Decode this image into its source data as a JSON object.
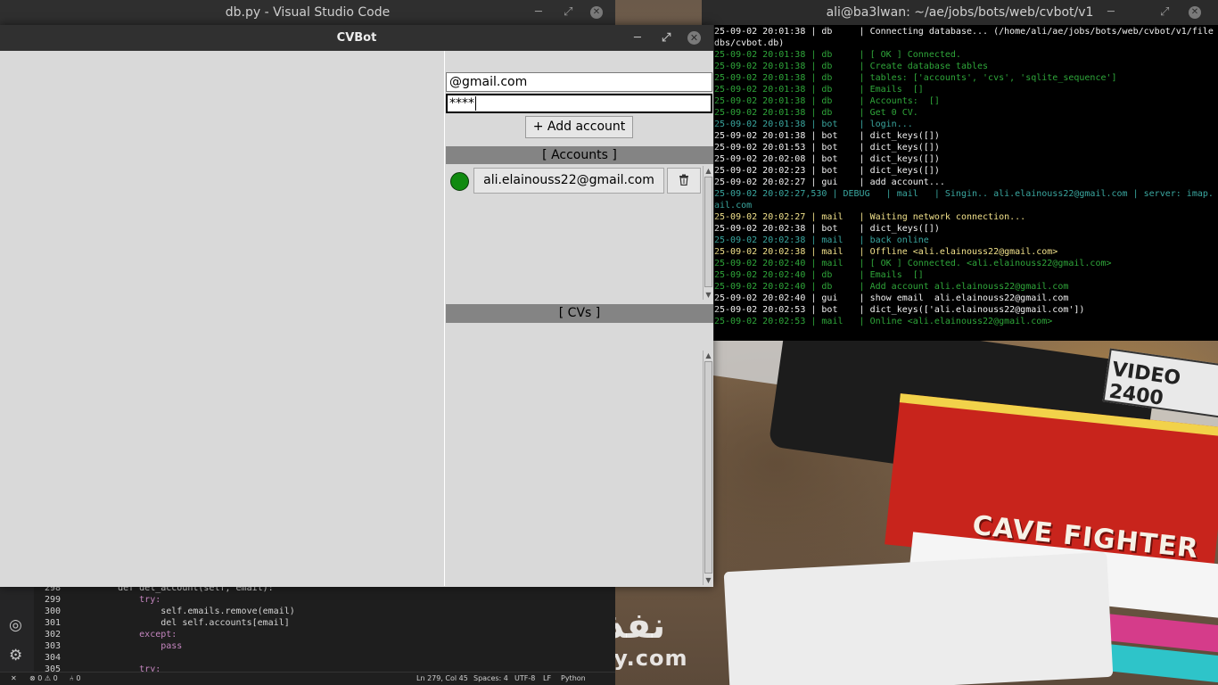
{
  "vscode": {
    "title": "db.py - Visual Studio Code",
    "code_lines": [
      {
        "num": "298",
        "text": "    def del_account(self, email):"
      },
      {
        "num": "299",
        "text": "        try:"
      },
      {
        "num": "300",
        "text": "            self.emails.remove(email)"
      },
      {
        "num": "301",
        "text": "            del self.accounts[email]"
      },
      {
        "num": "302",
        "text": "        except:"
      },
      {
        "num": "303",
        "text": "            pass"
      },
      {
        "num": "304",
        "text": ""
      },
      {
        "num": "305",
        "text": "        try:"
      }
    ],
    "status": {
      "errors": "⊗ 0 ⚠ 0",
      "ports": "⑃ 0",
      "position": "Ln 279, Col 45",
      "spaces": "Spaces: 4",
      "encoding": "UTF-8",
      "eol": "LF",
      "language": "Python"
    }
  },
  "terminal": {
    "title": "ali@ba3lwan: ~/ae/jobs/bots/web/cvbot/v1",
    "lines": [
      {
        "text": "25-09-02 20:01:38 | db     | Connecting database... (/home/ali/ae/jobs/bots/web/cvbot/v1/file",
        "color": "white"
      },
      {
        "text": "dbs/cvbot.db)",
        "color": "white"
      },
      {
        "text": "25-09-02 20:01:38 | db     | [ OK ] Connected.",
        "color": "green"
      },
      {
        "text": "25-09-02 20:01:38 | db     | Create database tables",
        "color": "green"
      },
      {
        "text": "25-09-02 20:01:38 | db     | tables: ['accounts', 'cvs', 'sqlite_sequence']",
        "color": "green"
      },
      {
        "text": "25-09-02 20:01:38 | db     | Emails  []",
        "color": "green"
      },
      {
        "text": "25-09-02 20:01:38 | db     | Accounts:  []",
        "color": "green"
      },
      {
        "text": "25-09-02 20:01:38 | db     | Get 0 CV.",
        "color": "green"
      },
      {
        "text": "25-09-02 20:01:38 | bot    | login...",
        "color": "cyan"
      },
      {
        "text": "25-09-02 20:01:38 | bot    | dict_keys([])",
        "color": "white"
      },
      {
        "text": "25-09-02 20:01:53 | bot    | dict_keys([])",
        "color": "white"
      },
      {
        "text": "25-09-02 20:02:08 | bot    | dict_keys([])",
        "color": "white"
      },
      {
        "text": "25-09-02 20:02:23 | bot    | dict_keys([])",
        "color": "white"
      },
      {
        "text": "25-09-02 20:02:27 | gui    | add account...",
        "color": "white"
      },
      {
        "text": "25-09-02 20:02:27,530 | DEBUG   | mail   | Singin.. ali.elainouss22@gmail.com | server: imap.",
        "color": "cyan"
      },
      {
        "text": "ail.com",
        "color": "cyan"
      },
      {
        "text": "25-09-02 20:02:27 | mail   | Waiting network connection...",
        "color": "yellow"
      },
      {
        "text": "25-09-02 20:02:38 | bot    | dict_keys([])",
        "color": "white"
      },
      {
        "text": "25-09-02 20:02:38 | mail   | back online",
        "color": "cyan"
      },
      {
        "text": "25-09-02 20:02:38 | mail   | Offline <ali.elainouss22@gmail.com>",
        "color": "yellow"
      },
      {
        "text": "25-09-02 20:02:40 | mail   | [ OK ] Connected. <ali.elainouss22@gmail.com>",
        "color": "green"
      },
      {
        "text": "25-09-02 20:02:40 | db     | Emails  []",
        "color": "green"
      },
      {
        "text": "25-09-02 20:02:40 | db     | Add account ali.elainouss22@gmail.com",
        "color": "green"
      },
      {
        "text": "25-09-02 20:02:40 | gui    | show email  ali.elainouss22@gmail.com",
        "color": "white"
      },
      {
        "text": "25-09-02 20:02:53 | bot    | dict_keys(['ali.elainouss22@gmail.com'])",
        "color": "white"
      },
      {
        "text": "25-09-02 20:02:53 | mail   | Online <ali.elainouss22@gmail.com>",
        "color": "green"
      }
    ]
  },
  "cvbot": {
    "title": "CVBot",
    "email_value": "@gmail.com",
    "password_value": "****",
    "add_account_label": "+ Add account",
    "accounts_header": "[ Accounts ]",
    "account": {
      "email": "ali.elainouss22@gmail.com",
      "status": "online",
      "status_color": "#108a10"
    },
    "cvs_header": "[ CVs ]"
  },
  "wallpaper": {
    "game_label": "CAVE FIGHTER",
    "box_label": "VIDEO 2400",
    "watermark_arabic": "نفذلي",
    "watermark_latin": "nafezly.com"
  },
  "colors": {
    "online": "#108a10",
    "term_green": "#2fa63a",
    "term_yellow": "#f0e08a",
    "term_cyan": "#3aa7a0"
  }
}
